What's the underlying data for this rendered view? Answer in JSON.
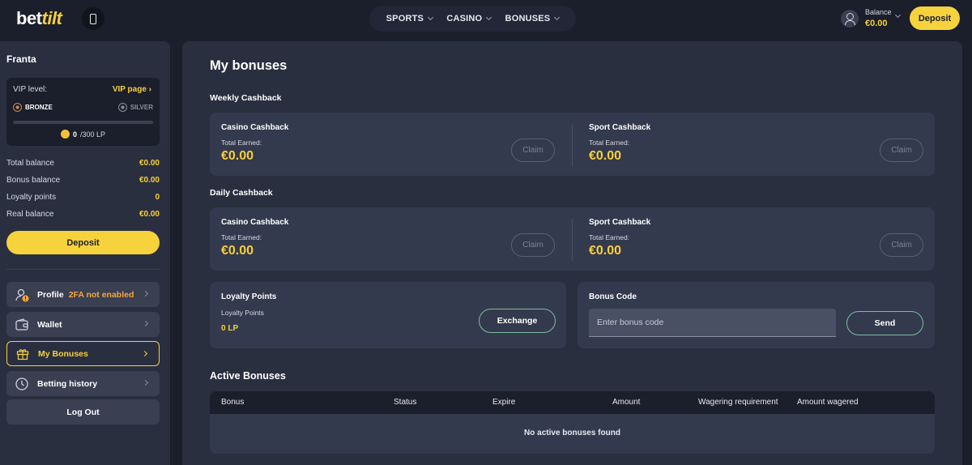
{
  "header": {
    "logo": {
      "part1": "bet",
      "part2": "tilt"
    },
    "nav": [
      {
        "label": "SPORTS"
      },
      {
        "label": "CASINO"
      },
      {
        "label": "BONUSES"
      }
    ],
    "balance_label": "Balance",
    "balance_value": "€0.00",
    "deposit_label": "Deposit"
  },
  "sidebar": {
    "username": "Franta",
    "vip": {
      "label": "VIP level:",
      "link": "VIP page ›",
      "current_tier": "BRONZE",
      "next_tier": "SILVER",
      "progress_fraction": 0,
      "points": "0",
      "points_suffix": "/300 LP"
    },
    "stats": [
      {
        "label": "Total balance",
        "value": "€0.00"
      },
      {
        "label": "Bonus balance",
        "value": "€0.00"
      },
      {
        "label": "Loyalty points",
        "value": "0"
      },
      {
        "label": "Real balance",
        "value": "€0.00"
      }
    ],
    "deposit_label": "Deposit",
    "menu": [
      {
        "label": "Profile",
        "warning": "2FA not enabled"
      },
      {
        "label": "Wallet"
      },
      {
        "label": "My Bonuses"
      },
      {
        "label": "Betting history"
      }
    ],
    "logout_label": "Log Out"
  },
  "main": {
    "title": "My bonuses",
    "weekly": {
      "label": "Weekly Cashback",
      "casino": {
        "title": "Casino Cashback",
        "sub": "Total Earned:",
        "amount": "€0.00",
        "claim": "Claim"
      },
      "sport": {
        "title": "Sport Cashback",
        "sub": "Total Earned:",
        "amount": "€0.00",
        "claim": "Claim"
      }
    },
    "daily": {
      "label": "Daily Cashback",
      "casino": {
        "title": "Casino Cashback",
        "sub": "Total Earned:",
        "amount": "€0.00",
        "claim": "Claim"
      },
      "sport": {
        "title": "Sport Cashback",
        "sub": "Total Earned:",
        "amount": "€0.00",
        "claim": "Claim"
      }
    },
    "loyalty": {
      "title": "Loyalty Points",
      "sub": "Loyalty Points",
      "value": "0 LP",
      "button": "Exchange"
    },
    "bonus_code": {
      "title": "Bonus Code",
      "placeholder": "Enter bonus code",
      "button": "Send"
    },
    "active_bonuses": {
      "title": "Active Bonuses",
      "columns": [
        "Bonus",
        "Status",
        "Expire",
        "Amount",
        "Wagering requirement",
        "Amount wagered"
      ],
      "empty_text": "No active bonuses found"
    }
  },
  "colors": {
    "accent": "#f6cf3a",
    "background": "#1b1e2b",
    "panel": "#2a2f40",
    "card": "#343a4d",
    "warning": "#f6a73a",
    "outline_green": "#7dbd9e"
  }
}
